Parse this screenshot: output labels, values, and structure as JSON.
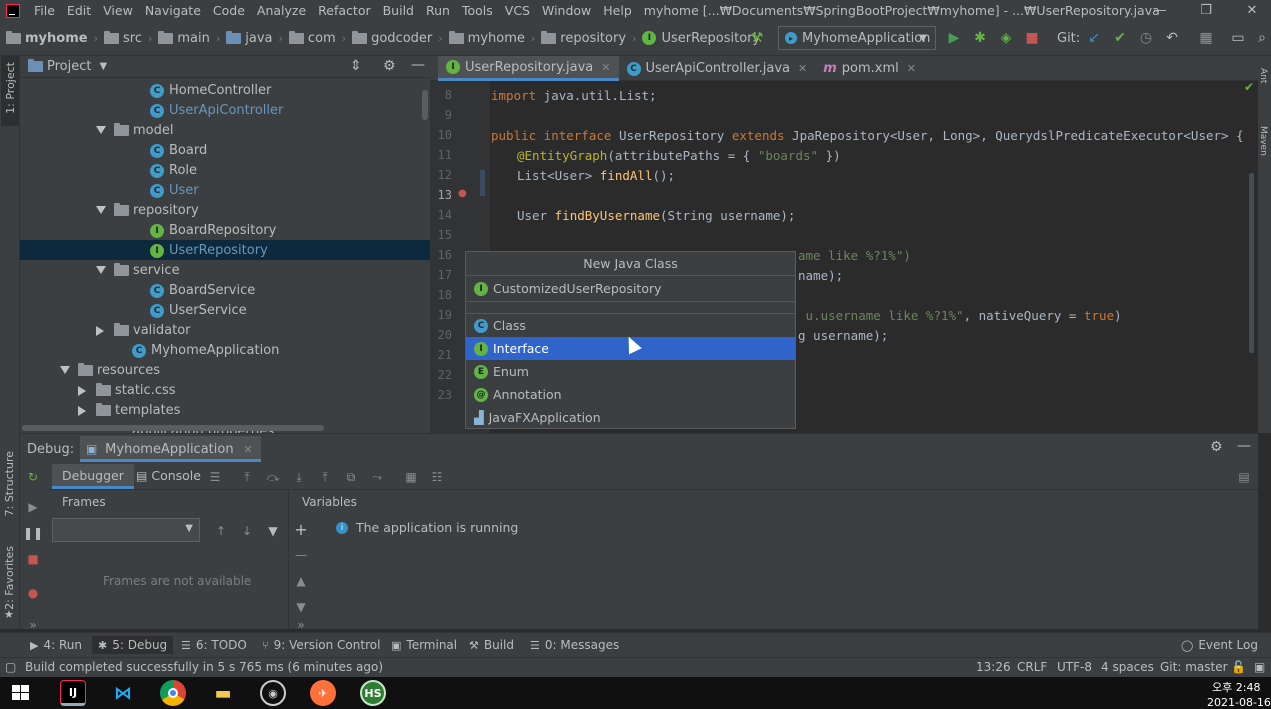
{
  "menubar": {
    "items": [
      "File",
      "Edit",
      "View",
      "Navigate",
      "Code",
      "Analyze",
      "Refactor",
      "Build",
      "Run",
      "Tools",
      "VCS",
      "Window",
      "Help"
    ],
    "title": "myhome [...₩Documents₩SpringBootProject₩myhome] - ...₩UserRepository.java"
  },
  "breadcrumb": [
    "myhome",
    "src",
    "main",
    "java",
    "com",
    "godcoder",
    "myhome",
    "repository",
    "UserRepository"
  ],
  "run_config": "MyhomeApplication",
  "git_label": "Git:",
  "project_panel": {
    "title": "Project",
    "rows": [
      {
        "label": "HomeController",
        "kind": "class",
        "indent": 130,
        "arrow": ""
      },
      {
        "label": "UserApiController",
        "kind": "class",
        "indent": 130,
        "arrow": "",
        "blue": true
      },
      {
        "label": "model",
        "kind": "folder",
        "indent": 94,
        "arrow": "down"
      },
      {
        "label": "Board",
        "kind": "class",
        "indent": 130,
        "arrow": ""
      },
      {
        "label": "Role",
        "kind": "class",
        "indent": 130,
        "arrow": ""
      },
      {
        "label": "User",
        "kind": "class",
        "indent": 130,
        "arrow": "",
        "blue": true
      },
      {
        "label": "repository",
        "kind": "folder",
        "indent": 94,
        "arrow": "down"
      },
      {
        "label": "BoardRepository",
        "kind": "interface",
        "indent": 130,
        "arrow": ""
      },
      {
        "label": "UserRepository",
        "kind": "interface",
        "indent": 130,
        "arrow": "",
        "selected": true,
        "blue": true
      },
      {
        "label": "service",
        "kind": "folder",
        "indent": 94,
        "arrow": "down"
      },
      {
        "label": "BoardService",
        "kind": "class",
        "indent": 130,
        "arrow": ""
      },
      {
        "label": "UserService",
        "kind": "class",
        "indent": 130,
        "arrow": ""
      },
      {
        "label": "validator",
        "kind": "folder",
        "indent": 94,
        "arrow": "right"
      },
      {
        "label": "MyhomeApplication",
        "kind": "app",
        "indent": 112,
        "arrow": ""
      },
      {
        "label": "resources",
        "kind": "folder",
        "indent": 58,
        "arrow": "down"
      },
      {
        "label": "static.css",
        "kind": "folder",
        "indent": 76,
        "arrow": "right"
      },
      {
        "label": "templates",
        "kind": "folder",
        "indent": 76,
        "arrow": "right"
      }
    ],
    "partial_row": "application.properties"
  },
  "editor": {
    "tabs": [
      {
        "label": "UserRepository.java",
        "kind": "interface",
        "active": true
      },
      {
        "label": "UserApiController.java",
        "kind": "class",
        "active": false
      },
      {
        "label": "pom.xml",
        "kind": "maven",
        "active": false
      }
    ],
    "line_numbers": [
      "8",
      "9",
      "10",
      "11",
      "12",
      "13",
      "14",
      "15",
      "16",
      "17",
      "18",
      "19",
      "20",
      "21",
      "22",
      "23"
    ],
    "code_lines": {
      "l9_kw": "import",
      "l9_rest": " java.util.List;",
      "l11_kw1": "public",
      "l11_kw2": " interface",
      "l11_name": " UserRepository",
      "l11_kw3": " extends",
      "l11_rest": " JpaRepository<User, Long>, QuerydslPredicateExecutor<User> {",
      "l12_ann": "@EntityGraph",
      "l12_rest": "(attributePaths = { ",
      "l12_str": "\"boards\"",
      "l12_end": " })",
      "l13_a": "List<User> ",
      "l13_fn": "findAll",
      "l13_b": "();",
      "l15_a": "User ",
      "l15_fn": "findByUsername",
      "l15_b": "(String username);",
      "l17_str": "ame like %?1%\")",
      "l18_a": "name);",
      "l20_str": " u.username like %?1%\"",
      "l20_mid": ", nativeQuery = ",
      "l20_kw": "true",
      "l20_end": ")",
      "l21_a": "g username);"
    }
  },
  "popup": {
    "title": "New Java Class",
    "input_value": "CustomizedUserRepository",
    "items": [
      {
        "label": "Class",
        "kind": "class"
      },
      {
        "label": "Interface",
        "kind": "interface",
        "selected": true
      },
      {
        "label": "Enum",
        "kind": "enum"
      },
      {
        "label": "Annotation",
        "kind": "annotation"
      },
      {
        "label": "JavaFXApplication",
        "kind": "fx"
      }
    ]
  },
  "debug": {
    "label": "Debug:",
    "session_tab": "MyhomeApplication",
    "debugger_tab": "Debugger",
    "console_tab": "Console",
    "frames_header": "Frames",
    "variables_header": "Variables",
    "frames_empty": "Frames are not available",
    "variables_message": "The application is running"
  },
  "bottom_tools": [
    {
      "label": "4: Run",
      "icon": "▶"
    },
    {
      "label": "5: Debug",
      "icon": "✱"
    },
    {
      "label": "6: TODO",
      "icon": "☰"
    },
    {
      "label": "9: Version Control",
      "icon": "⑂"
    },
    {
      "label": "Terminal",
      "icon": "▣"
    },
    {
      "label": "Build",
      "icon": "⚒"
    },
    {
      "label": "0: Messages",
      "icon": "☰"
    }
  ],
  "event_log": "Event Log",
  "status": {
    "message": "Build completed successfully in 5 s 765 ms (6 minutes ago)",
    "position": "13:26",
    "line_sep": "CRLF",
    "encoding": "UTF-8",
    "indent": "4 spaces",
    "git_branch": "Git: master"
  },
  "side_labels": {
    "project": "1: Project",
    "structure": "7: Structure",
    "favorites": "2: Favorites",
    "ant": "Ant",
    "maven": "Maven"
  },
  "taskbar": {
    "clock_time": "오후 2:48",
    "clock_date": "2021-08-16",
    "hs_label": "HS"
  }
}
